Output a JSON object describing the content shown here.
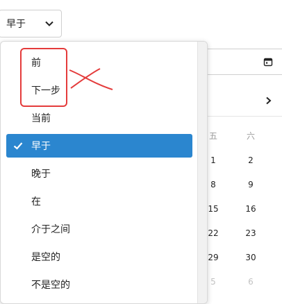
{
  "select": {
    "value": "早于",
    "icon": "chevron-down-icon"
  },
  "date_input": {
    "icon": "calendar-icon"
  },
  "calendar": {
    "next_icon": "chevron-right-icon",
    "weekdays": [
      "五",
      "六"
    ],
    "days": {
      "r1": [
        "1",
        "2"
      ],
      "r2": [
        "8",
        "9"
      ],
      "r3": [
        "15",
        "16"
      ],
      "r4": [
        "22",
        "23"
      ],
      "r5": [
        "29",
        "30"
      ],
      "r6": [
        "5",
        "6"
      ]
    }
  },
  "menu": {
    "items": [
      {
        "label": "前"
      },
      {
        "label": "下一步"
      },
      {
        "label": "当前"
      },
      {
        "label": "早于",
        "selected": true
      },
      {
        "label": "晚于"
      },
      {
        "label": "在"
      },
      {
        "label": "介于之间"
      },
      {
        "label": "是空的"
      },
      {
        "label": "不是空的"
      }
    ]
  },
  "colors": {
    "selected_bg": "#2b86cf",
    "annotation": "#e43b3b"
  }
}
